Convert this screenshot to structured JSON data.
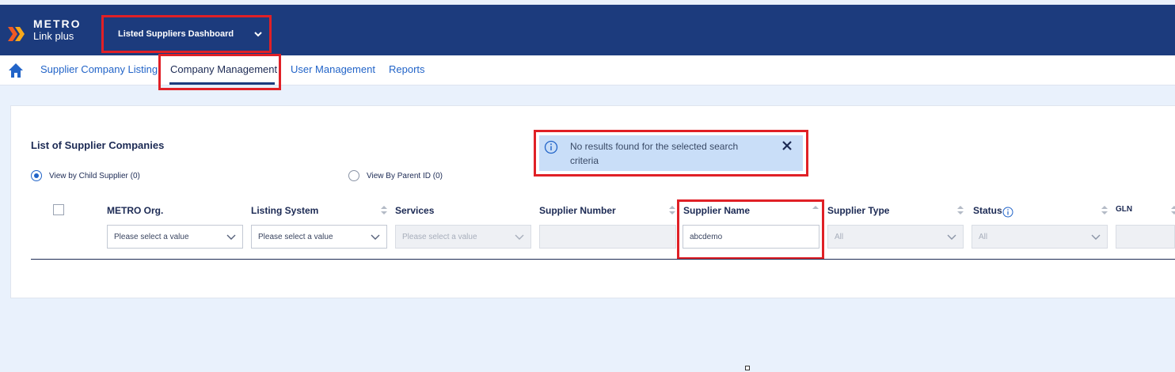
{
  "header": {
    "brand_line1": "METRO",
    "brand_line2": "Link plus",
    "dashboard_select": "Listed Suppliers Dashboard"
  },
  "nav": {
    "items": [
      {
        "label": "Supplier Company Listing"
      },
      {
        "label": "Company Management"
      },
      {
        "label": "User Management"
      },
      {
        "label": "Reports"
      }
    ]
  },
  "main": {
    "title": "List of Supplier Companies",
    "alert": "No results found for the selected search criteria",
    "radios": [
      {
        "label": "View by Child Supplier (0)",
        "selected": true
      },
      {
        "label": "View By Parent ID (0)",
        "selected": false
      }
    ],
    "columns": [
      {
        "label": "METRO Org."
      },
      {
        "label": "Listing System"
      },
      {
        "label": "Services"
      },
      {
        "label": "Supplier Number"
      },
      {
        "label": "Supplier Name"
      },
      {
        "label": "Supplier Type"
      },
      {
        "label": "Status"
      },
      {
        "label": "GLN"
      }
    ],
    "filters": {
      "metro_org": "Please select a value",
      "listing_system": "Please select a value",
      "services": "Please select a value",
      "supplier_number": "",
      "supplier_name": "abcdemo",
      "supplier_type": "All",
      "status": "All",
      "gln": ""
    }
  },
  "colors": {
    "header_bg": "#1c3b7d",
    "link": "#2264c8",
    "highlight": "#e02026",
    "alert_bg": "#c9def8",
    "page_bg": "#e9f1fc"
  }
}
